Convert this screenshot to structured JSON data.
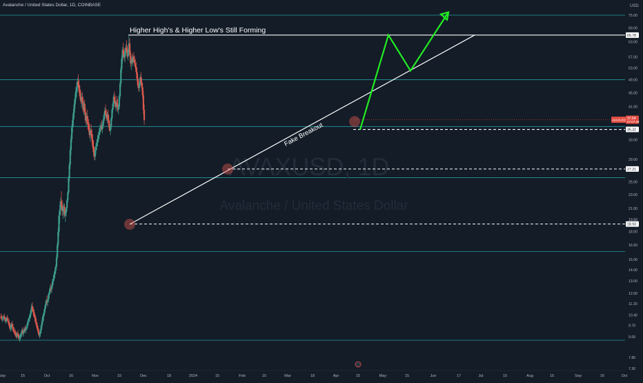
{
  "header": {
    "symbol_title": "Avalanche / United States Dollar, 1D, COINBASE",
    "currency_label": "USD"
  },
  "watermark": {
    "ticker": "AVAXUSD, 1D",
    "name": "Avalanche / United States Dollar"
  },
  "annotations": {
    "top_text": "Higher High's & Higher Low's Still Forming",
    "trendline_text": "Fake Breakout"
  },
  "colors": {
    "background": "#131c27",
    "up_candle": "#3d9a8b",
    "down_candle": "#d9574d",
    "cyan_line": "#2ab1b7",
    "projection": "#22ee22",
    "white": "#ffffff",
    "tag_red": "#e04c41"
  },
  "chart_data": {
    "type": "candlestick",
    "title": "Avalanche / United States Dollar, 1D, COINBASE",
    "y_scale": "log",
    "ylim": [
      7.0,
      78.0
    ],
    "y_ticks": [
      75.0,
      69.0,
      63.0,
      57.0,
      53.0,
      49.0,
      45.0,
      41.0,
      37.0,
      33.0,
      29.0,
      25.0,
      23.0,
      21.0,
      19.5,
      18.0,
      16.5,
      15.0,
      14.0,
      13.0,
      12.0,
      11.2,
      10.4,
      9.7,
      9.0,
      7.85,
      7.3
    ],
    "x_ticks": [
      "Sep",
      "15",
      "Oct",
      "16",
      "Nov",
      "15",
      "Dec",
      "18",
      "2024",
      "15",
      "Feb",
      "15",
      "Mar",
      "18",
      "Apr",
      "15",
      "May",
      "15",
      "Jun",
      "17",
      "Jul",
      "15",
      "Aug",
      "15",
      "Sep",
      "16",
      "Oct"
    ],
    "horizontal_levels": [
      {
        "price": 65.78,
        "label": "65.78",
        "style": "solid-white"
      },
      {
        "price": 35.32,
        "label": "35.32",
        "style": "dashed-white"
      },
      {
        "price": 27.21,
        "label": "27.21",
        "style": "dashed-white"
      },
      {
        "price": 18.93,
        "label": "18.93",
        "style": "dashed-white"
      }
    ],
    "support_resistance_lines": [
      75.0,
      49.0,
      36.0,
      25.7,
      15.8,
      8.8
    ],
    "current_price": {
      "ticker": "AVAXUSD",
      "price": 37.64,
      "countdown": "07:07:28"
    },
    "trendline": {
      "from": {
        "date": "Nov 30",
        "price": 18.9
      },
      "to": {
        "date": "Jun 30",
        "price": 65.78
      }
    },
    "projection_path": [
      {
        "date": "Apr 15",
        "price": 35.3
      },
      {
        "date": "Apr 30",
        "price": 65.78
      },
      {
        "date": "May 15",
        "price": 52.0
      },
      {
        "date": "Jun 06",
        "price": 76.5
      }
    ],
    "highlight_points": [
      {
        "date": "Nov 30",
        "price": 18.9
      },
      {
        "date": "Jan 23",
        "price": 27.21
      },
      {
        "date": "Apr 13",
        "price": 37.2
      }
    ],
    "series": [
      {
        "type": "ohlc_daily",
        "start": "Sep 01",
        "ohlc": [
          [
            10.3,
            10.5,
            10.1,
            10.2
          ],
          [
            10.2,
            10.4,
            10.0,
            10.1
          ],
          [
            10.1,
            10.3,
            9.9,
            10.2
          ],
          [
            10.2,
            10.4,
            10.0,
            10.3
          ],
          [
            10.3,
            10.5,
            10.1,
            10.2
          ],
          [
            10.2,
            10.3,
            9.9,
            10.0
          ],
          [
            10.0,
            10.2,
            9.8,
            10.1
          ],
          [
            10.1,
            10.3,
            9.9,
            10.2
          ],
          [
            10.2,
            10.4,
            10.0,
            10.0
          ],
          [
            10.0,
            10.2,
            9.8,
            9.9
          ],
          [
            9.9,
            10.1,
            9.6,
            9.7
          ],
          [
            9.7,
            9.9,
            9.4,
            9.5
          ],
          [
            9.5,
            9.8,
            9.3,
            9.6
          ],
          [
            9.6,
            9.9,
            9.4,
            9.8
          ],
          [
            9.8,
            10.0,
            9.5,
            9.6
          ],
          [
            9.6,
            9.8,
            9.3,
            9.4
          ],
          [
            9.4,
            9.6,
            9.2,
            9.3
          ],
          [
            9.3,
            9.5,
            9.1,
            9.2
          ],
          [
            9.2,
            9.4,
            9.0,
            9.1
          ],
          [
            9.1,
            9.3,
            8.9,
            9.0
          ],
          [
            9.0,
            9.3,
            8.9,
            9.2
          ],
          [
            9.2,
            9.4,
            9.0,
            9.1
          ],
          [
            9.1,
            9.2,
            8.8,
            8.9
          ],
          [
            8.9,
            9.1,
            8.7,
            9.0
          ],
          [
            9.0,
            9.2,
            8.8,
            9.1
          ],
          [
            9.1,
            9.3,
            8.9,
            9.2
          ],
          [
            9.2,
            9.5,
            9.0,
            9.4
          ],
          [
            9.4,
            9.6,
            9.1,
            9.2
          ],
          [
            9.2,
            9.4,
            9.0,
            9.3
          ],
          [
            9.3,
            9.6,
            9.2,
            9.5
          ],
          [
            9.5,
            9.7,
            9.3,
            9.4
          ],
          [
            9.4,
            9.6,
            9.2,
            9.5
          ],
          [
            9.5,
            9.8,
            9.4,
            9.7
          ],
          [
            9.7,
            10.0,
            9.5,
            9.9
          ],
          [
            9.9,
            10.2,
            9.7,
            10.1
          ],
          [
            10.1,
            10.4,
            9.9,
            10.2
          ],
          [
            10.2,
            10.5,
            10.0,
            10.4
          ],
          [
            10.4,
            10.8,
            10.2,
            10.7
          ],
          [
            10.7,
            11.2,
            10.5,
            11.0
          ],
          [
            11.0,
            11.3,
            10.6,
            10.8
          ],
          [
            10.8,
            11.0,
            10.4,
            10.6
          ],
          [
            10.6,
            10.8,
            10.2,
            10.3
          ],
          [
            10.3,
            10.5,
            10.0,
            10.2
          ],
          [
            10.2,
            10.4,
            9.8,
            9.9
          ],
          [
            9.9,
            10.1,
            9.6,
            9.7
          ],
          [
            9.7,
            9.9,
            9.4,
            9.5
          ],
          [
            9.5,
            9.7,
            9.2,
            9.3
          ],
          [
            9.3,
            9.5,
            9.0,
            9.1
          ],
          [
            9.1,
            9.3,
            8.9,
            9.2
          ],
          [
            9.2,
            9.5,
            9.0,
            9.4
          ],
          [
            9.4,
            9.8,
            9.2,
            9.7
          ],
          [
            9.7,
            10.2,
            9.5,
            10.0
          ],
          [
            10.0,
            10.4,
            9.8,
            10.3
          ],
          [
            10.3,
            10.6,
            10.0,
            10.5
          ],
          [
            10.5,
            10.9,
            10.3,
            10.8
          ],
          [
            10.8,
            11.2,
            10.6,
            11.1
          ],
          [
            11.1,
            11.5,
            10.9,
            11.4
          ],
          [
            11.4,
            11.8,
            11.1,
            11.3
          ],
          [
            11.3,
            11.6,
            11.0,
            11.5
          ],
          [
            11.5,
            12.0,
            11.3,
            11.9
          ],
          [
            11.9,
            12.3,
            11.6,
            12.1
          ],
          [
            12.1,
            12.6,
            11.9,
            12.4
          ],
          [
            12.4,
            12.8,
            12.1,
            12.3
          ],
          [
            12.3,
            12.7,
            12.0,
            12.6
          ],
          [
            12.6,
            13.2,
            12.4,
            13.0
          ],
          [
            13.0,
            13.5,
            12.7,
            13.2
          ],
          [
            13.2,
            13.8,
            13.0,
            13.6
          ],
          [
            13.6,
            14.2,
            13.3,
            13.9
          ],
          [
            13.9,
            14.5,
            13.6,
            14.3
          ],
          [
            14.3,
            15.5,
            14.1,
            15.2
          ],
          [
            15.2,
            16.8,
            15.0,
            16.5
          ],
          [
            16.5,
            18.5,
            16.2,
            18.0
          ],
          [
            18.0,
            20.5,
            17.5,
            20.0
          ],
          [
            20.0,
            21.5,
            19.0,
            20.8
          ],
          [
            20.8,
            22.5,
            20.2,
            22.0
          ],
          [
            22.0,
            23.5,
            21.0,
            21.5
          ],
          [
            21.5,
            22.2,
            20.0,
            20.6
          ],
          [
            20.6,
            21.4,
            19.6,
            20.9
          ],
          [
            20.9,
            21.8,
            20.2,
            21.2
          ],
          [
            21.2,
            21.6,
            19.8,
            20.0
          ],
          [
            20.0,
            20.8,
            19.2,
            20.4
          ],
          [
            20.4,
            21.2,
            19.9,
            21.0
          ],
          [
            21.0,
            22.4,
            20.6,
            22.1
          ],
          [
            22.1,
            23.6,
            21.8,
            23.3
          ],
          [
            23.3,
            26.0,
            23.0,
            25.6
          ],
          [
            25.6,
            28.5,
            25.0,
            28.0
          ],
          [
            28.0,
            31.5,
            27.2,
            30.8
          ],
          [
            30.8,
            34.0,
            29.8,
            33.2
          ],
          [
            33.2,
            36.5,
            32.4,
            35.8
          ],
          [
            35.8,
            38.5,
            34.6,
            37.6
          ],
          [
            37.6,
            40.5,
            36.0,
            39.4
          ],
          [
            39.4,
            42.8,
            38.2,
            41.6
          ],
          [
            41.6,
            44.6,
            40.5,
            43.4
          ],
          [
            43.4,
            46.8,
            42.5,
            45.5
          ],
          [
            45.5,
            48.2,
            43.8,
            46.6
          ],
          [
            46.6,
            49.6,
            45.0,
            48.4
          ],
          [
            48.4,
            50.8,
            46.5,
            47.2
          ],
          [
            47.2,
            49.0,
            44.8,
            45.6
          ],
          [
            45.6,
            47.4,
            43.2,
            44.0
          ],
          [
            44.0,
            46.0,
            42.0,
            42.6
          ],
          [
            42.6,
            44.8,
            40.8,
            43.6
          ],
          [
            43.6,
            45.2,
            41.5,
            42.0
          ],
          [
            42.0,
            43.8,
            39.6,
            40.2
          ],
          [
            40.2,
            42.6,
            38.8,
            41.8
          ],
          [
            41.8,
            43.0,
            39.0,
            39.5
          ],
          [
            39.5,
            40.8,
            36.8,
            37.5
          ],
          [
            37.5,
            39.4,
            36.0,
            38.6
          ],
          [
            38.6,
            40.2,
            36.6,
            37.0
          ],
          [
            37.0,
            38.6,
            35.2,
            36.4
          ],
          [
            36.4,
            37.8,
            34.6,
            35.2
          ],
          [
            35.2,
            36.8,
            33.4,
            34.0
          ],
          [
            34.0,
            35.6,
            32.6,
            35.1
          ],
          [
            35.1,
            36.6,
            33.6,
            34.2
          ],
          [
            34.2,
            35.4,
            32.2,
            33.0
          ],
          [
            33.0,
            34.2,
            31.0,
            31.5
          ],
          [
            31.5,
            32.8,
            29.6,
            30.4
          ],
          [
            30.4,
            31.6,
            28.9,
            29.5
          ],
          [
            29.5,
            31.2,
            28.8,
            30.8
          ],
          [
            30.8,
            32.2,
            30.0,
            31.6
          ],
          [
            31.6,
            33.0,
            30.8,
            32.4
          ],
          [
            32.4,
            34.0,
            31.6,
            33.2
          ],
          [
            33.2,
            34.6,
            32.4,
            34.0
          ],
          [
            34.0,
            35.6,
            33.0,
            34.8
          ],
          [
            34.8,
            36.4,
            34.0,
            35.6
          ],
          [
            35.6,
            37.0,
            34.6,
            36.2
          ],
          [
            36.2,
            37.6,
            35.0,
            35.4
          ],
          [
            35.4,
            36.8,
            34.4,
            36.2
          ],
          [
            36.2,
            38.0,
            35.6,
            37.4
          ],
          [
            37.4,
            39.4,
            36.8,
            38.8
          ],
          [
            38.8,
            40.8,
            38.0,
            40.0
          ],
          [
            40.0,
            41.6,
            38.6,
            39.0
          ],
          [
            39.0,
            40.4,
            37.4,
            38.0
          ],
          [
            38.0,
            39.6,
            36.8,
            39.0
          ],
          [
            39.0,
            40.2,
            37.0,
            37.6
          ],
          [
            37.6,
            38.8,
            35.6,
            36.2
          ],
          [
            36.2,
            37.4,
            34.8,
            35.0
          ],
          [
            35.0,
            36.6,
            34.0,
            36.0
          ],
          [
            36.0,
            38.4,
            35.4,
            38.0
          ],
          [
            38.0,
            40.6,
            37.4,
            40.2
          ],
          [
            40.2,
            42.4,
            39.4,
            41.8
          ],
          [
            41.8,
            44.6,
            41.0,
            43.8
          ],
          [
            43.8,
            45.4,
            42.0,
            42.6
          ],
          [
            42.6,
            44.2,
            40.6,
            41.0
          ],
          [
            41.0,
            42.8,
            39.8,
            42.2
          ],
          [
            42.2,
            44.0,
            41.0,
            41.6
          ],
          [
            41.6,
            43.2,
            39.6,
            40.2
          ],
          [
            40.2,
            41.8,
            39.0,
            41.0
          ],
          [
            41.0,
            44.6,
            40.4,
            44.0
          ],
          [
            44.0,
            48.6,
            43.2,
            47.8
          ],
          [
            47.8,
            53.6,
            46.8,
            52.6
          ],
          [
            52.6,
            57.6,
            51.2,
            56.4
          ],
          [
            56.4,
            60.8,
            54.6,
            59.6
          ],
          [
            59.6,
            62.6,
            57.2,
            58.0
          ],
          [
            58.0,
            60.4,
            55.6,
            56.8
          ],
          [
            56.8,
            59.8,
            55.0,
            58.8
          ],
          [
            58.8,
            62.0,
            57.4,
            60.6
          ],
          [
            60.6,
            63.6,
            58.4,
            59.2
          ],
          [
            59.2,
            61.4,
            56.4,
            57.2
          ],
          [
            57.2,
            60.2,
            55.6,
            59.6
          ],
          [
            59.6,
            65.4,
            58.6,
            62.2
          ],
          [
            62.2,
            64.4,
            56.8,
            57.6
          ],
          [
            57.6,
            59.4,
            53.4,
            54.6
          ],
          [
            54.6,
            56.8,
            52.2,
            56.2
          ],
          [
            56.2,
            58.4,
            54.4,
            55.0
          ],
          [
            55.0,
            57.6,
            53.6,
            57.0
          ],
          [
            57.0,
            58.8,
            55.0,
            55.8
          ],
          [
            55.8,
            57.4,
            53.8,
            54.6
          ],
          [
            54.6,
            56.2,
            52.6,
            53.2
          ],
          [
            53.2,
            55.0,
            51.0,
            51.6
          ],
          [
            51.6,
            53.2,
            48.6,
            49.4
          ],
          [
            49.4,
            51.0,
            46.4,
            47.2
          ],
          [
            47.2,
            48.8,
            45.4,
            46.4
          ],
          [
            46.4,
            48.4,
            45.2,
            47.6
          ],
          [
            47.6,
            50.6,
            47.0,
            49.8
          ],
          [
            49.8,
            51.6,
            47.4,
            48.2
          ],
          [
            48.2,
            49.6,
            45.6,
            46.6
          ],
          [
            46.6,
            47.8,
            43.4,
            44.2
          ],
          [
            44.2,
            45.6,
            39.0,
            40.2
          ],
          [
            40.2,
            41.6,
            36.4,
            37.6
          ]
        ]
      }
    ]
  }
}
